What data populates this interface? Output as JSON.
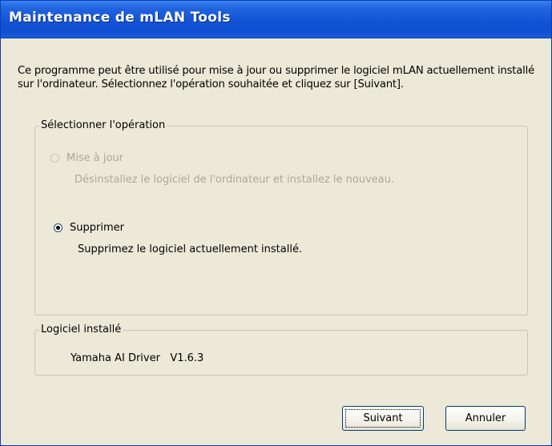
{
  "window": {
    "title": "Maintenance de mLAN Tools"
  },
  "description": "Ce programme peut être utilisé pour mise à jour ou supprimer le logiciel mLAN actuellement installé sur l'ordinateur. Sélectionnez l'opération souhaitée et cliquez sur [Suivant].",
  "operation_group": {
    "legend": "Sélectionner l'opération",
    "options": [
      {
        "label": "Mise à jour",
        "description": "Désinstallez le logiciel de l'ordinateur et installez le nouveau.",
        "enabled": false,
        "selected": false
      },
      {
        "label": "Supprimer",
        "description": "Supprimez le logiciel actuellement installé.",
        "enabled": true,
        "selected": true
      }
    ]
  },
  "installed_group": {
    "legend": "Logiciel installé",
    "driver_name": "Yamaha AI Driver",
    "driver_version": "V1.6.3"
  },
  "buttons": {
    "next_label": "Suivant",
    "cancel_label": "Annuler"
  }
}
